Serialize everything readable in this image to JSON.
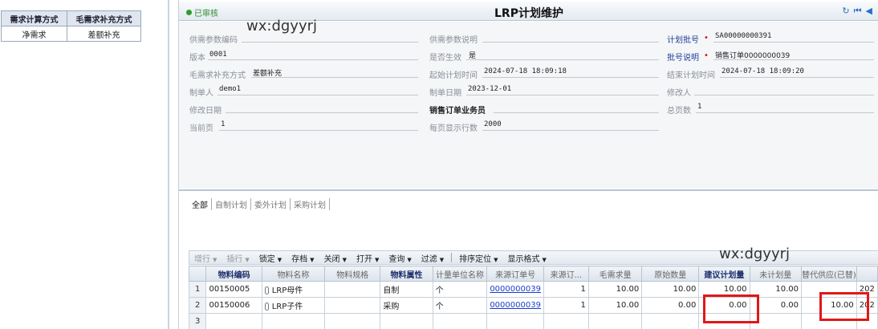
{
  "left_table": {
    "headers": [
      "需求计算方式",
      "毛需求补充方式"
    ],
    "row": [
      "净需求",
      "差额补充"
    ]
  },
  "header": {
    "status": "已审核",
    "title": "LRP计划维护",
    "icons": [
      "refresh-icon",
      "first-icon",
      "prev-icon"
    ]
  },
  "form": {
    "col1": [
      {
        "label": "供需参数编码",
        "value": ""
      },
      {
        "label": "版本",
        "value": "0001"
      },
      {
        "label": "毛需求补充方式",
        "value": "差额补充"
      },
      {
        "label": "制单人",
        "value": "demo1"
      },
      {
        "label": "修改日期",
        "value": ""
      },
      {
        "label": "当前页",
        "value": "1"
      }
    ],
    "col2": [
      {
        "label": "供需参数说明",
        "value": ""
      },
      {
        "label": "是否生效",
        "value": "是"
      },
      {
        "label": "起始计划时间",
        "value": "2024-07-18 18:09:18"
      },
      {
        "label": "制单日期",
        "value": "2023-12-01"
      },
      {
        "label": "销售订单业务员",
        "value": ""
      },
      {
        "label": "每页显示行数",
        "value": "2000"
      }
    ],
    "col3": [
      {
        "label": "计划批号",
        "value": "SA00000000391"
      },
      {
        "label": "批号说明",
        "value": "销售订单0000000039"
      },
      {
        "label": "结束计划时间",
        "value": "2024-07-18 18:09:20"
      },
      {
        "label": "修改人",
        "value": ""
      },
      {
        "label": "总页数",
        "value": "1"
      }
    ]
  },
  "tabs": [
    "全部",
    "自制计划",
    "委外计划",
    "采购计划"
  ],
  "toolbar": [
    {
      "label": "增行",
      "disabled": true
    },
    {
      "label": "插行",
      "disabled": true
    },
    {
      "label": "锁定",
      "disabled": false
    },
    {
      "label": "存档",
      "disabled": false
    },
    {
      "label": "关闭",
      "disabled": false
    },
    {
      "label": "打开",
      "disabled": false
    },
    {
      "label": "查询",
      "disabled": false
    },
    {
      "label": "过滤",
      "disabled": false
    },
    {
      "label": "排序定位",
      "disabled": false
    },
    {
      "label": "显示格式",
      "disabled": false
    }
  ],
  "grid": {
    "columns": [
      "",
      "物料编码",
      "物料名称",
      "物料规格",
      "物料属性",
      "计量单位名称",
      "来源订单号",
      "来源订...",
      "毛需求量",
      "原始数量",
      "建议计划量",
      "未计划量",
      "替代供应(已替)",
      ""
    ],
    "rows": [
      [
        "1",
        "00150005",
        "LRP母件",
        "",
        "自制",
        "个",
        "0000000039",
        "1",
        "10.00",
        "10.00",
        "10.00",
        "10.00",
        "",
        "202"
      ],
      [
        "2",
        "00150006",
        "LRP子件",
        "",
        "采购",
        "个",
        "0000000039",
        "1",
        "10.00",
        "0.00",
        "0.00",
        "0.00",
        "10.00",
        "202"
      ],
      [
        "3",
        "",
        "",
        "",
        "",
        "",
        "",
        "",
        "",
        "",
        "",
        "",
        "",
        ""
      ]
    ]
  },
  "watermarks": [
    "wx:dgyyrj",
    "wx:dgyyrj"
  ]
}
